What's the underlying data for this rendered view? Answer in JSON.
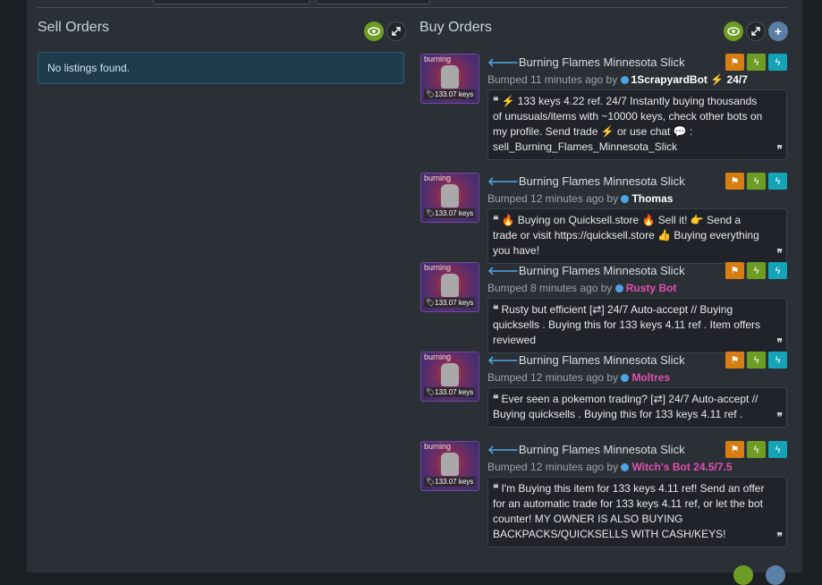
{
  "sell_orders": {
    "title": "Sell Orders",
    "empty_message": "No listings found."
  },
  "buy_orders": {
    "title": "Buy Orders",
    "listings": [
      {
        "item_name": "Burning Flames Minnesota Slick",
        "effect_label": "burning",
        "price_tag": "133.07 keys",
        "bumped_text": "Bumped 11 minutes ago by",
        "user": "1ScrapyardBot ⚡ 24/7",
        "description": "⚡ 133 keys 4.22 ref. 24/7 Instantly buying thousands of unusuals/items with ~10000 keys, check other bots on my profile. Send  trade ⚡ or  use  chat 💬 : sell_Burning_Flames_Minnesota_Slick"
      },
      {
        "item_name": "Burning Flames Minnesota Slick",
        "effect_label": "burning",
        "price_tag": "133.07 keys",
        "bumped_text": "Bumped 12 minutes ago by",
        "user": "Thomas",
        "description": "🔥 Buying on Quicksell.store 🔥 Sell it! 👉 Send a trade or visit https://quicksell.store 👍 Buying everything you have!"
      },
      {
        "item_name": "Burning Flames Minnesota Slick",
        "effect_label": "burning",
        "price_tag": "133.07 keys",
        "bumped_text": "Bumped 8 minutes ago by",
        "user": "Rusty Bot",
        "description": "Rusty but efficient [⇄] 24/7 Auto-accept // Buying quicksells . Buying this for 133 keys 4.11 ref . Item offers reviewed"
      },
      {
        "item_name": "Burning Flames Minnesota Slick",
        "effect_label": "burning",
        "price_tag": "133.07 keys",
        "bumped_text": "Bumped 12 minutes ago by",
        "user": "Moltres",
        "description": "Ever seen a pokemon trading? [⇄] 24/7 Auto-accept // Buying quicksells . Buying this for 133 keys 4.11 ref ."
      },
      {
        "item_name": "Burning Flames Minnesota Slick",
        "effect_label": "burning",
        "price_tag": "133.07 keys",
        "bumped_text": "Bumped 12 minutes ago by",
        "user": "Witch's Bot 24.5/7.5",
        "description": "I'm Buying this item for 133 keys 4.11 ref! Send an offer for an automatic trade for 133 keys 4.11 ref, or let the bot counter! MY OWNER IS ALSO BUYING BACKPACKS/QUICKSELLS WITH CASH/KEYS!"
      }
    ]
  },
  "icons": {
    "eye": "eye-icon",
    "expand": "expand-icon",
    "plus": "plus-icon",
    "flag": "flag-icon",
    "bolt": "lightning-icon",
    "arrow": "arrow-left-icon"
  },
  "colors": {
    "background": "#2b3036",
    "eye_button": "#6e9d26",
    "flag_button": "#d67e12",
    "bolt_button": "#6e9d26",
    "bolt2_button": "#15a3b8",
    "pink_user": "#e24fb2",
    "alert_bg": "#1f3a4a"
  }
}
